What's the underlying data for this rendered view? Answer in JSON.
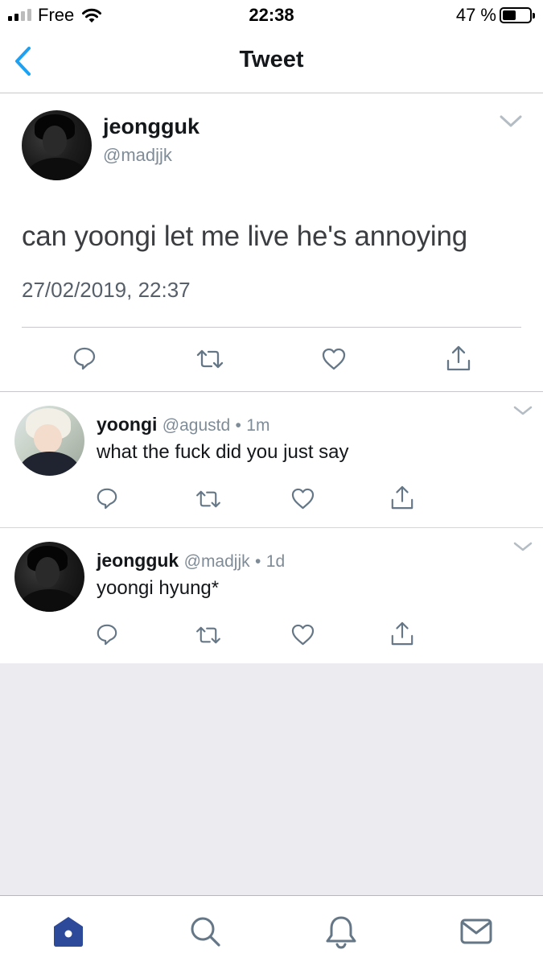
{
  "status_bar": {
    "carrier": "Free",
    "time": "22:38",
    "battery": "47 %",
    "battery_level": 0.47,
    "signal_bars_filled": 2,
    "signal_bars_total": 4
  },
  "nav": {
    "title": "Tweet",
    "back_icon": "chevron-left-icon"
  },
  "main_tweet": {
    "display_name": "jeongguk",
    "handle": "@madjjk",
    "text": "can yoongi let me live he's annoying",
    "timestamp": "27/02/2019, 22:37"
  },
  "replies": [
    {
      "display_name": "yoongi",
      "handle": "@agustd",
      "time": "1m",
      "text": "what the fuck did you just say"
    },
    {
      "display_name": "jeongguk",
      "handle": "@madjjk",
      "time": "1d",
      "text": "yoongi hyung*"
    }
  ],
  "tabs": [
    "home-icon",
    "search-icon",
    "notifications-bell-icon",
    "messages-envelope-icon"
  ],
  "colors": {
    "accent": "#1da1f2",
    "home_active": "#2c4a99",
    "icon_gray": "#657786",
    "handle_gray": "#7f8c97",
    "empty_bg": "#ebebf0"
  }
}
